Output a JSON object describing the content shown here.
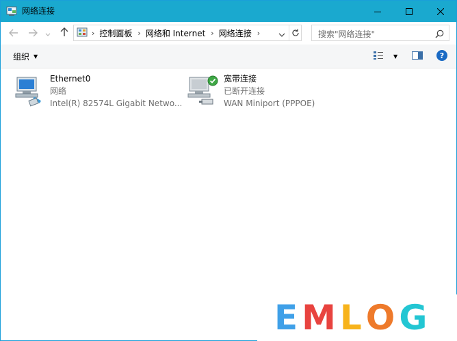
{
  "window": {
    "title": "网络连接",
    "controls": {
      "minimize": "—",
      "maximize": "☐",
      "close": "✕"
    }
  },
  "nav": {
    "breadcrumbs": [
      "控制面板",
      "网络和 Internet",
      "网络连接"
    ],
    "search_placeholder": "搜索\"网络连接\""
  },
  "toolbar": {
    "organize_label": "组织",
    "help_label": "?"
  },
  "connections": [
    {
      "name": "Ethernet0",
      "status": "网络",
      "device": "Intel(R) 82574L Gigabit Netwo...",
      "icon": "ethernet-adapter-icon"
    },
    {
      "name": "宽带连接",
      "status": "已断开连接",
      "device": "WAN Miniport (PPPOE)",
      "icon": "broadband-connection-icon"
    }
  ],
  "watermark": {
    "letters": [
      "E",
      "M",
      "L",
      "O",
      "G"
    ],
    "colors": [
      "#3fa0e8",
      "#e8433f",
      "#f7b31b",
      "#ee7a2b",
      "#23c6d3"
    ]
  },
  "colors": {
    "titlebar": "#1aa9cf",
    "accent": "#1a6ac4"
  }
}
